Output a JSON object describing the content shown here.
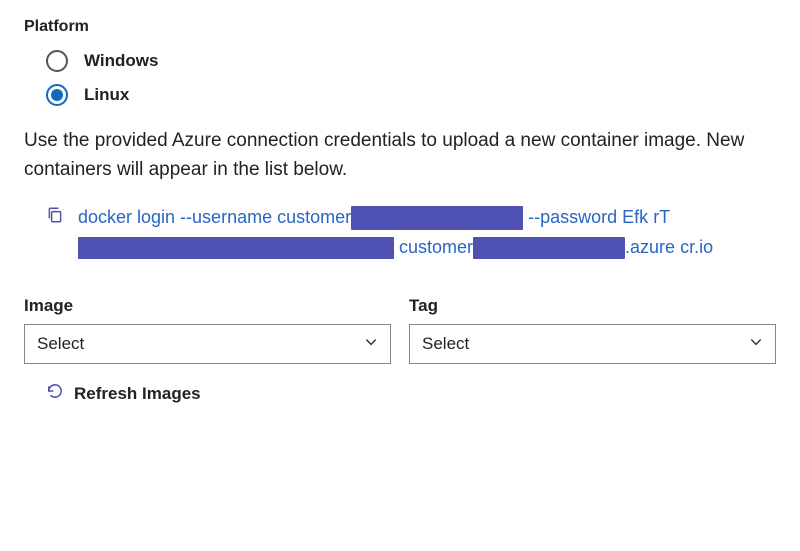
{
  "platform": {
    "label": "Platform",
    "options": [
      {
        "label": "Windows",
        "selected": false
      },
      {
        "label": "Linux",
        "selected": true
      }
    ]
  },
  "description": "Use the provided Azure connection credentials to upload a new container image. New containers will appear in the list below.",
  "command": {
    "seg_login": "docker login --username customer",
    "seg_password_flag": " --password Efk",
    "seg_rt": "rT",
    "seg_customer2": " customer",
    "seg_azure": ".azure",
    "seg_crio": "cr.io"
  },
  "fields": {
    "image": {
      "label": "Image",
      "value": "Select"
    },
    "tag": {
      "label": "Tag",
      "value": "Select"
    }
  },
  "refresh_label": "Refresh Images"
}
